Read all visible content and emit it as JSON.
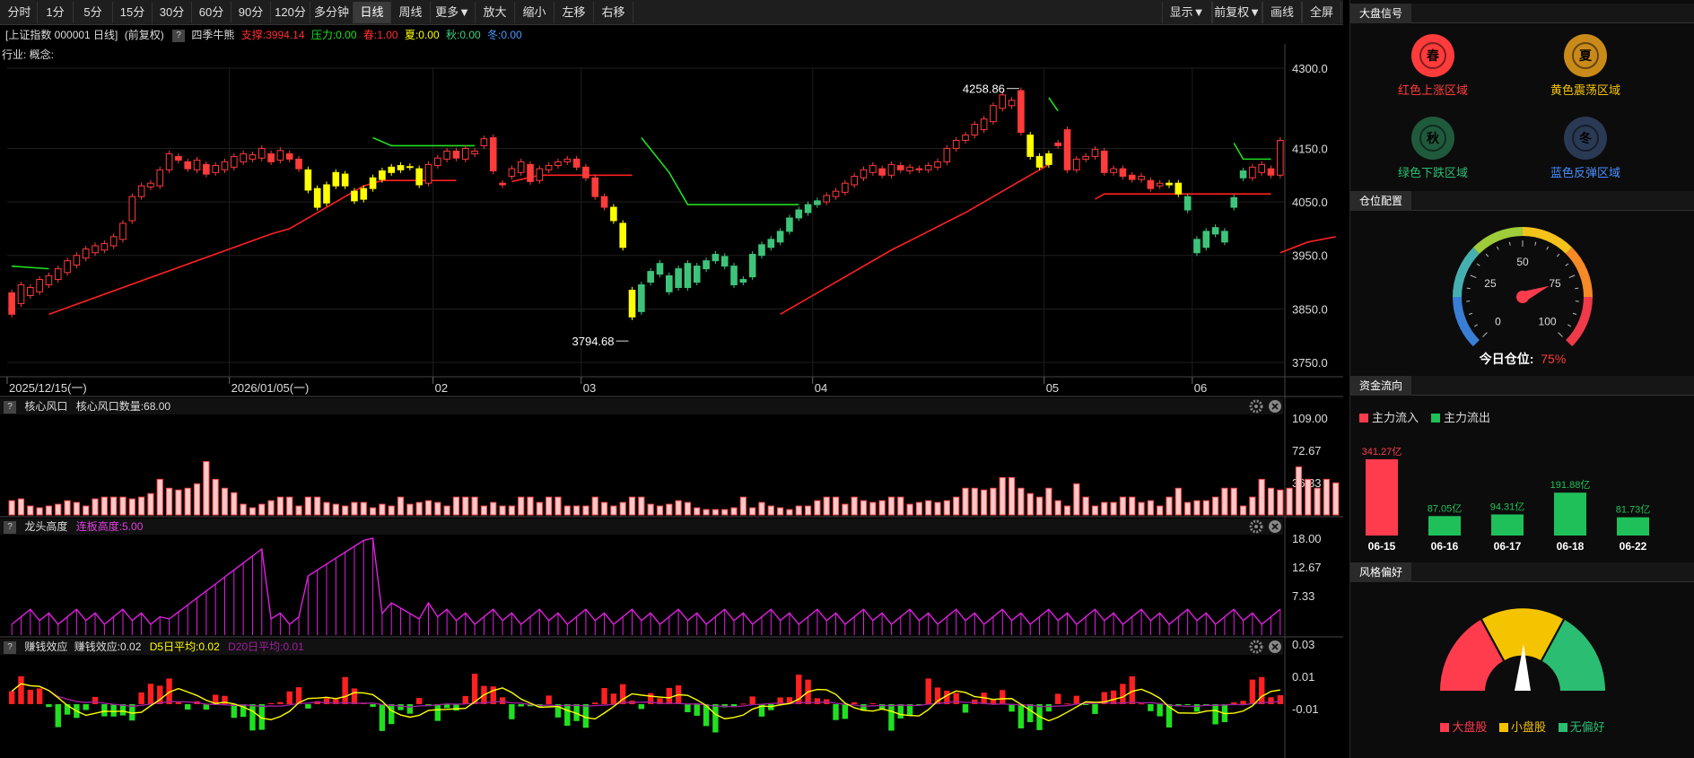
{
  "toolbar": {
    "left": [
      "分时",
      "1分",
      "5分",
      "15分",
      "30分",
      "60分",
      "90分",
      "120分",
      "多分钟",
      "日线",
      "周线",
      "更多▼",
      "放大",
      "缩小",
      "左移",
      "右移"
    ],
    "active": "日线",
    "right": [
      "显示▼",
      "前复权▼",
      "画线",
      "全屏"
    ]
  },
  "info": {
    "name": "[上证指数 000001 日线]",
    "adj": "(前复权)",
    "ind": "四季牛熊",
    "support": "支撑:3994.14",
    "pressure": "压力:0.00",
    "spring": "春:1.00",
    "summer": "夏:0.00",
    "autumn": "秋:0.00",
    "winter": "冬:0.00",
    "industry": "行业: 概念:"
  },
  "price_axis": [
    "4300.0",
    "4150.0",
    "4050.0",
    "3950.0",
    "3850.0",
    "3750.0"
  ],
  "annotations": {
    "high": "4258.86",
    "low": "3794.68"
  },
  "date_axis": [
    "2025/12/15(一)",
    "2026/01/05(一)",
    "02",
    "03",
    "04",
    "05",
    "06"
  ],
  "panels": {
    "p1": {
      "title": "核心风口",
      "line": "核心风口数量:68.00",
      "ticks": [
        "109.00",
        "72.67",
        "36.33"
      ]
    },
    "p2": {
      "title": "龙头高度",
      "line": "连板高度:5.00",
      "ticks": [
        "18.00",
        "12.67",
        "7.33"
      ]
    },
    "p3": {
      "title": "赚钱效应",
      "line": "赚钱效应:0.02",
      "d5": "D5日平均:0.02",
      "d20": "D20日平均:0.01",
      "ticks": [
        "0.03",
        "0.01",
        "-0.01"
      ]
    }
  },
  "right": {
    "sec1": "大盘信号",
    "signals": [
      {
        "glyph": "春",
        "label": "红色上涨区域",
        "color": "#ff3b3b"
      },
      {
        "glyph": "夏",
        "label": "黄色震荡区域",
        "color": "#c98a1a"
      },
      {
        "glyph": "秋",
        "label": "绿色下跌区域",
        "color": "#1f5a3c"
      },
      {
        "glyph": "冬",
        "label": "蓝色反弹区域",
        "color": "#2a3a55"
      }
    ],
    "sec2": "仓位配置",
    "gauge_ticks": [
      "0",
      "25",
      "50",
      "75",
      "100"
    ],
    "position_label": "今日仓位:",
    "position_value": "75%",
    "position_pct": 75,
    "sec3": "资金流向",
    "legend_in": "主力流入",
    "legend_out": "主力流出",
    "flows": [
      {
        "date": "06-15",
        "value": "341.27亿",
        "v": 341.27,
        "dir": "in"
      },
      {
        "date": "06-16",
        "value": "87.05亿",
        "v": 87.05,
        "dir": "out"
      },
      {
        "date": "06-17",
        "value": "94.31亿",
        "v": 94.31,
        "dir": "out"
      },
      {
        "date": "06-18",
        "value": "191.88亿",
        "v": 191.88,
        "dir": "out"
      },
      {
        "date": "06-22",
        "value": "81.73亿",
        "v": 81.73,
        "dir": "out"
      }
    ],
    "sec4": "风格偏好",
    "style_legend": [
      "大盘股",
      "小盘股",
      "无偏好"
    ]
  },
  "chart_data": {
    "type": "candlestick",
    "ylim": [
      3750,
      4300
    ],
    "candles": [
      [
        3880,
        3840
      ],
      [
        3860,
        3895
      ],
      [
        3875,
        3890
      ],
      [
        3882,
        3905
      ],
      [
        3895,
        3912
      ],
      [
        3905,
        3925
      ],
      [
        3918,
        3940
      ],
      [
        3932,
        3950
      ],
      [
        3945,
        3962
      ],
      [
        3955,
        3968
      ],
      [
        3960,
        3972
      ],
      [
        3968,
        3985
      ],
      [
        3980,
        4010
      ],
      [
        4015,
        4060
      ],
      [
        4060,
        4080
      ],
      [
        4078,
        4085
      ],
      [
        4080,
        4110
      ],
      [
        4110,
        4140
      ],
      [
        4135,
        4128
      ],
      [
        4125,
        4112
      ],
      [
        4110,
        4128
      ],
      [
        4120,
        4102
      ],
      [
        4105,
        4118
      ],
      [
        4110,
        4125
      ],
      [
        4115,
        4135
      ],
      [
        4125,
        4140
      ],
      [
        4130,
        4138
      ],
      [
        4132,
        4150
      ],
      [
        4140,
        4125
      ],
      [
        4128,
        4146
      ],
      [
        4140,
        4130
      ],
      [
        4130,
        4112
      ],
      [
        4110,
        4072
      ],
      [
        4075,
        4040
      ],
      [
        4048,
        4082
      ],
      [
        4080,
        4105
      ],
      [
        4102,
        4080
      ],
      [
        4070,
        4052
      ],
      [
        4055,
        4075
      ],
      [
        4075,
        4095
      ],
      [
        4092,
        4108
      ],
      [
        4105,
        4115
      ],
      [
        4110,
        4118
      ],
      [
        4115,
        4116
      ],
      [
        4112,
        4082
      ],
      [
        4085,
        4120
      ],
      [
        4118,
        4132
      ],
      [
        4130,
        4145
      ],
      [
        4145,
        4132
      ],
      [
        4130,
        4150
      ],
      [
        4140,
        4145
      ],
      [
        4155,
        4168
      ],
      [
        4170,
        4108
      ],
      [
        4085,
        4082
      ],
      [
        4098,
        4112
      ],
      [
        4105,
        4125
      ],
      [
        4120,
        4088
      ],
      [
        4090,
        4112
      ],
      [
        4110,
        4118
      ],
      [
        4118,
        4125
      ],
      [
        4125,
        4130
      ],
      [
        4130,
        4115
      ],
      [
        4115,
        4095
      ],
      [
        4095,
        4060
      ],
      [
        4060,
        4040
      ],
      [
        4040,
        4015
      ],
      [
        4010,
        3965
      ],
      [
        3835,
        3885
      ],
      [
        3845,
        3895
      ],
      [
        3900,
        3920
      ],
      [
        3915,
        3935
      ],
      [
        3912,
        3882
      ],
      [
        3890,
        3925
      ],
      [
        3935,
        3890
      ],
      [
        3900,
        3930
      ],
      [
        3925,
        3940
      ],
      [
        3940,
        3952
      ],
      [
        3948,
        3930
      ],
      [
        3930,
        3895
      ],
      [
        3900,
        3905
      ],
      [
        3910,
        3952
      ],
      [
        3950,
        3970
      ],
      [
        3965,
        3980
      ],
      [
        3975,
        3995
      ],
      [
        3995,
        4020
      ],
      [
        4020,
        4035
      ],
      [
        4030,
        4045
      ],
      [
        4045,
        4052
      ],
      [
        4050,
        4062
      ],
      [
        4060,
        4070
      ],
      [
        4068,
        4085
      ],
      [
        4082,
        4098
      ],
      [
        4095,
        4110
      ],
      [
        4105,
        4118
      ],
      [
        4112,
        4100
      ],
      [
        4100,
        4120
      ],
      [
        4118,
        4110
      ],
      [
        4108,
        4115
      ],
      [
        4112,
        4110
      ],
      [
        4110,
        4118
      ],
      [
        4115,
        4125
      ],
      [
        4125,
        4150
      ],
      [
        4150,
        4165
      ],
      [
        4165,
        4175
      ],
      [
        4175,
        4195
      ],
      [
        4185,
        4205
      ],
      [
        4200,
        4230
      ],
      [
        4225,
        4250
      ],
      [
        4230,
        4240
      ],
      [
        4258,
        4180
      ],
      [
        4175,
        4135
      ],
      [
        4135,
        4115
      ],
      [
        4120,
        4140
      ],
      [
        4160,
        4155
      ],
      [
        4185,
        4110
      ],
      [
        4110,
        4130
      ],
      [
        4130,
        4135
      ],
      [
        4135,
        4148
      ],
      [
        4145,
        4105
      ],
      [
        4105,
        4112
      ],
      [
        4112,
        4098
      ],
      [
        4100,
        4092
      ],
      [
        4092,
        4098
      ],
      [
        4090,
        4075
      ],
      [
        4080,
        4085
      ],
      [
        4082,
        4085
      ],
      [
        4085,
        4065
      ],
      [
        4060,
        4035
      ],
      [
        3980,
        3955
      ],
      [
        3965,
        3995
      ],
      [
        3990,
        4002
      ],
      [
        3995,
        3975
      ],
      [
        4040,
        4058
      ],
      [
        4095,
        4108
      ],
      [
        4095,
        4115
      ],
      [
        4105,
        4120
      ],
      [
        4112,
        4100
      ],
      [
        4100,
        4165
      ]
    ],
    "support_segments": [
      [
        [
          4,
          3840
        ],
        [
          28,
          3990
        ],
        [
          30,
          4000
        ],
        [
          38,
          4080
        ],
        [
          40,
          4090
        ],
        [
          48,
          4090
        ]
      ],
      [
        [
          54,
          4088
        ],
        [
          57,
          4100
        ],
        [
          67,
          4100
        ]
      ],
      [
        [
          83,
          3840
        ],
        [
          95,
          3960
        ],
        [
          103,
          4030
        ],
        [
          104,
          4040
        ],
        [
          108,
          4080
        ],
        [
          110,
          4100
        ],
        [
          111,
          4110
        ],
        [
          112,
          4120
        ]
      ],
      [
        [
          117,
          4055
        ],
        [
          118,
          4065
        ],
        [
          136,
          4065
        ]
      ],
      [
        [
          137,
          3955
        ],
        [
          140,
          3975
        ],
        [
          143,
          3985
        ]
      ]
    ],
    "pressure_segments": [
      [
        [
          0,
          3930
        ],
        [
          4,
          3925
        ]
      ],
      [
        [
          39,
          4170
        ],
        [
          41,
          4155
        ],
        [
          50,
          4155
        ]
      ],
      [
        [
          68,
          4170
        ],
        [
          71,
          4105
        ],
        [
          73,
          4045
        ],
        [
          85,
          4045
        ]
      ],
      [
        [
          112,
          4245
        ],
        [
          113,
          4220
        ]
      ],
      [
        [
          132,
          4160
        ],
        [
          133,
          4130
        ],
        [
          136,
          4130
        ]
      ]
    ],
    "hot_count": [
      16,
      18,
      10,
      8,
      10,
      12,
      16,
      14,
      10,
      18,
      20,
      20,
      20,
      18,
      20,
      24,
      40,
      30,
      28,
      30,
      35,
      60,
      40,
      30,
      25,
      12,
      8,
      12,
      16,
      20,
      20,
      10,
      20,
      20,
      14,
      12,
      10,
      14,
      14,
      8,
      12,
      10,
      20,
      12,
      14,
      16,
      14,
      10,
      20,
      20,
      20,
      10,
      14,
      10,
      10,
      20,
      20,
      14,
      20,
      20,
      10,
      10,
      10,
      20,
      14,
      10,
      14,
      20,
      20,
      12,
      10,
      12,
      16,
      14,
      8,
      6,
      6,
      6,
      8,
      20,
      8,
      14,
      10,
      8,
      6,
      10,
      10,
      16,
      20,
      20,
      12,
      20,
      16,
      14,
      16,
      20,
      20,
      12,
      14,
      16,
      14,
      16,
      20,
      30,
      30,
      28,
      30,
      42,
      42,
      30,
      24,
      20,
      30,
      16,
      10,
      35,
      20,
      10,
      14,
      14,
      20,
      20,
      14,
      16,
      10,
      20,
      30,
      14,
      16,
      16,
      20,
      30,
      30,
      10,
      20,
      40,
      30,
      28,
      30,
      54,
      40,
      30,
      40,
      36
    ]
  }
}
